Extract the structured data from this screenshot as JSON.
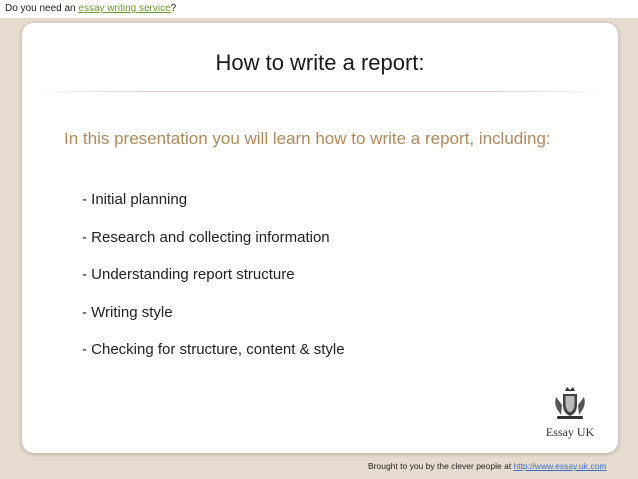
{
  "banner": {
    "prefix": "Do you need an ",
    "link_text": "essay writing service",
    "suffix": "?"
  },
  "slide": {
    "title": "How to write a report:",
    "intro": "In this presentation you will learn how to write a report, including:",
    "bullets": [
      "- Initial planning",
      "- Research and collecting information",
      "- Understanding report structure",
      "- Writing style",
      "- Checking for structure, content & style"
    ],
    "logo_text": "Essay UK"
  },
  "footer": {
    "prefix": "Brought to you by the clever people at ",
    "link_text": "http://www.essay.uk.com"
  },
  "colors": {
    "background": "#e5dccf",
    "link_green": "#6e9a2c",
    "intro_tan": "#b08a5a",
    "footer_link": "#3b6ec4"
  }
}
